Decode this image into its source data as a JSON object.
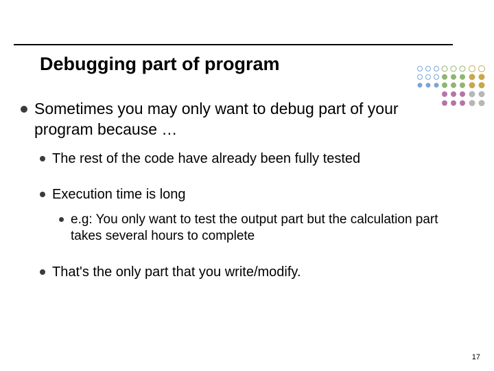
{
  "title": "Debugging part of program",
  "bullets": {
    "p1": "Sometimes you may only want to debug part of your program because …",
    "s1": "The rest of the code have already been fully tested",
    "s2": "Execution time is long",
    "s2a": "e.g: You only want to test the output part but the calculation part takes several hours to complete",
    "s3": "That's the only part that you write/modify."
  },
  "page_number": "17"
}
